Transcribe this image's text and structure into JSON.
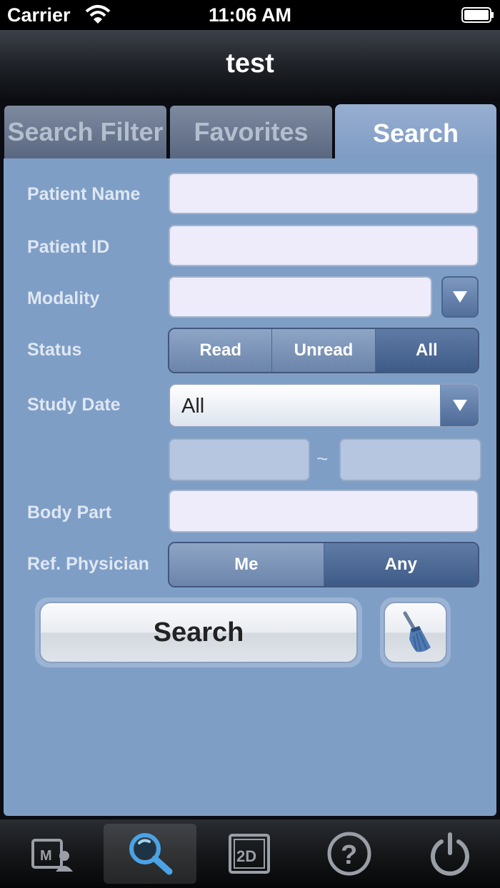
{
  "status_bar": {
    "carrier": "Carrier",
    "time": "11:06 AM"
  },
  "title": "test",
  "tabs": [
    {
      "label": "Search Filter",
      "active": false
    },
    {
      "label": "Favorites",
      "active": false
    },
    {
      "label": "Search",
      "active": true
    }
  ],
  "form": {
    "patient_name": {
      "label": "Patient Name",
      "value": ""
    },
    "patient_id": {
      "label": "Patient ID",
      "value": ""
    },
    "modality": {
      "label": "Modality",
      "value": ""
    },
    "status": {
      "label": "Status",
      "options": [
        "Read",
        "Unread",
        "All"
      ],
      "selected": "All"
    },
    "study_date": {
      "label": "Study Date",
      "value": "All",
      "from": "",
      "to": "",
      "separator": "~"
    },
    "body_part": {
      "label": "Body Part",
      "value": ""
    },
    "ref_physician": {
      "label": "Ref. Physician",
      "options": [
        "Me",
        "Any"
      ],
      "selected": "Any"
    }
  },
  "buttons": {
    "search": "Search",
    "clear_icon": "broom-icon"
  },
  "tab_bar": [
    {
      "icon": "patient-card-icon",
      "active": false
    },
    {
      "icon": "magnifier-icon",
      "active": true
    },
    {
      "icon": "2d-viewer-icon",
      "active": false
    },
    {
      "icon": "help-icon",
      "active": false
    },
    {
      "icon": "power-icon",
      "active": false
    }
  ],
  "colors": {
    "panel": "#7e9ec6",
    "accent": "#4a90d9",
    "segment_selected": "#3e5a86"
  }
}
